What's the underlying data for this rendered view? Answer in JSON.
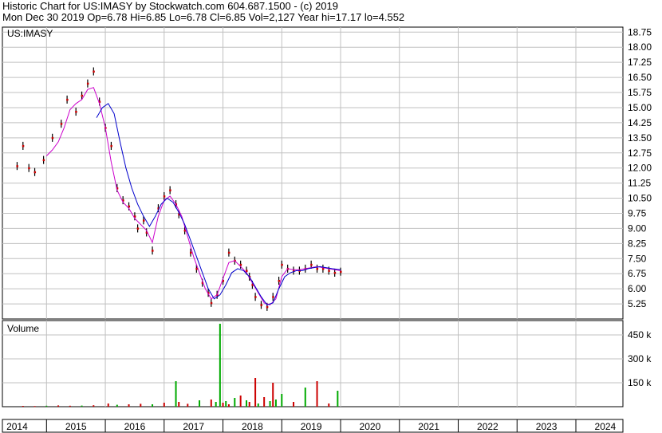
{
  "header": {
    "line1": "Historic Chart for US:IMASY by Stockwatch.com 604.687.1500 - (c) 2019",
    "line2": "Mon Dec 30 2019  Op=6.78  Hi=6.85  Lo=6.78  Cl=6.85  Vol=2,127  Year hi=17.17  lo=4.552"
  },
  "colors": {
    "price": "#cc0000",
    "bar": "#000000",
    "ma_short": "#cc00cc",
    "ma_long": "#0000cc",
    "volume_up": "#00aa00",
    "volume_down": "#cc0000",
    "grid": "#c0c0c0"
  },
  "chart_data": [
    {
      "type": "line",
      "title": "US:IMASY",
      "xlabel": "",
      "ylabel": "",
      "x_labels": [
        "2014",
        "2015",
        "2016",
        "2017",
        "2018",
        "2019",
        "2020",
        "2021",
        "2022",
        "2023",
        "2024"
      ],
      "ylim": [
        4.5,
        19.0
      ],
      "y_ticks": [
        "18.75",
        "18.00",
        "17.25",
        "16.50",
        "15.75",
        "15.00",
        "14.25",
        "13.50",
        "12.75",
        "12.00",
        "11.25",
        "10.50",
        "9.75",
        "9.00",
        "8.25",
        "7.50",
        "6.75",
        "6.00",
        "5.25"
      ],
      "grid": true,
      "series": [
        {
          "style": "price",
          "x": [
            2014.0,
            2014.1,
            2014.2,
            2014.3,
            2014.45,
            2014.6,
            2014.75,
            2014.85,
            2015.0,
            2015.1,
            2015.2,
            2015.3,
            2015.4,
            2015.5,
            2015.6,
            2015.7,
            2015.8,
            2015.9,
            2016.0,
            2016.05,
            2016.15,
            2016.2,
            2016.3,
            2016.4,
            2016.5,
            2016.6,
            2016.7,
            2016.75,
            2016.85,
            2016.95,
            2017.05,
            2017.15,
            2017.25,
            2017.3,
            2017.4,
            2017.5,
            2017.6,
            2017.7,
            2017.8,
            2017.9,
            2017.95,
            2018.0,
            2018.05,
            2018.15,
            2018.25,
            2018.35,
            2018.45,
            2018.5,
            2018.6,
            2018.7,
            2018.8,
            2018.9,
            2019.0,
            2019.1,
            2019.2,
            2019.3,
            2019.4,
            2019.5
          ],
          "values": [
            12.1,
            13.1,
            12.0,
            11.8,
            12.4,
            13.5,
            14.2,
            15.4,
            14.8,
            15.6,
            16.2,
            16.8,
            15.3,
            14.0,
            13.1,
            11.0,
            10.4,
            10.1,
            9.6,
            9.0,
            9.4,
            8.8,
            7.9,
            10.0,
            10.6,
            10.9,
            10.2,
            9.7,
            8.9,
            7.8,
            7.0,
            6.3,
            5.8,
            5.3,
            5.7,
            6.4,
            7.8,
            7.4,
            7.2,
            6.9,
            6.6,
            6.2,
            5.6,
            5.2,
            5.1,
            5.6,
            6.4,
            7.2,
            7.0,
            6.9,
            6.9,
            7.0,
            7.2,
            7.0,
            7.0,
            6.9,
            6.8,
            6.85
          ]
        },
        {
          "style": "ma_short",
          "x": [
            2014.5,
            2014.6,
            2014.7,
            2014.8,
            2014.9,
            2015.0,
            2015.1,
            2015.2,
            2015.3,
            2015.4,
            2015.5,
            2015.6,
            2015.7,
            2015.8,
            2015.9,
            2016.0,
            2016.1,
            2016.2,
            2016.3,
            2016.4,
            2016.5,
            2016.6,
            2016.7,
            2016.8,
            2016.9,
            2017.0,
            2017.1,
            2017.2,
            2017.3,
            2017.4,
            2017.5,
            2017.6,
            2017.7,
            2017.8,
            2017.9,
            2018.0,
            2018.1,
            2018.2,
            2018.3,
            2018.4,
            2018.5,
            2018.6,
            2018.7,
            2018.8,
            2018.9,
            2019.0,
            2019.1,
            2019.2,
            2019.3,
            2019.4,
            2019.5
          ],
          "values": [
            12.6,
            12.9,
            13.3,
            14.0,
            14.9,
            15.2,
            15.4,
            15.9,
            16.0,
            15.2,
            14.0,
            12.3,
            10.9,
            10.3,
            10.0,
            9.5,
            9.2,
            8.9,
            8.3,
            9.6,
            10.4,
            10.6,
            10.2,
            9.6,
            8.6,
            7.6,
            6.8,
            6.0,
            5.5,
            5.7,
            6.5,
            7.3,
            7.4,
            7.1,
            6.8,
            6.3,
            5.8,
            5.3,
            5.2,
            5.5,
            6.6,
            7.0,
            6.95,
            6.95,
            7.0,
            7.05,
            7.1,
            7.05,
            7.0,
            6.95,
            6.9
          ]
        },
        {
          "style": "ma_long",
          "x": [
            2015.35,
            2015.45,
            2015.55,
            2015.65,
            2015.75,
            2015.85,
            2015.95,
            2016.05,
            2016.15,
            2016.25,
            2016.35,
            2016.45,
            2016.55,
            2016.65,
            2016.75,
            2016.85,
            2016.95,
            2017.05,
            2017.15,
            2017.25,
            2017.35,
            2017.45,
            2017.55,
            2017.65,
            2017.75,
            2017.85,
            2017.95,
            2018.05,
            2018.15,
            2018.25,
            2018.35,
            2018.45,
            2018.55,
            2018.65,
            2018.75,
            2018.85,
            2018.95,
            2019.05,
            2019.15,
            2019.25,
            2019.35,
            2019.5
          ],
          "values": [
            14.5,
            15.0,
            15.2,
            14.7,
            13.3,
            12.0,
            11.0,
            10.2,
            9.6,
            9.1,
            9.6,
            10.2,
            10.5,
            10.3,
            9.8,
            9.2,
            8.4,
            7.6,
            6.8,
            6.0,
            5.5,
            5.7,
            6.2,
            6.8,
            7.0,
            6.9,
            6.6,
            6.1,
            5.6,
            5.2,
            5.3,
            6.0,
            6.6,
            6.8,
            6.9,
            6.9,
            7.0,
            7.05,
            7.1,
            7.05,
            7.0,
            6.95
          ]
        }
      ]
    },
    {
      "type": "bar",
      "title": "Volume",
      "x_labels": [
        "2014",
        "2015",
        "2016",
        "2017",
        "2018",
        "2019",
        "2020",
        "2021",
        "2022",
        "2023",
        "2024"
      ],
      "ylim": [
        0,
        540
      ],
      "y_ticks": [
        "450 k",
        "300 k",
        "150 k"
      ],
      "y_tick_values": [
        450,
        300,
        150
      ],
      "grid": true,
      "series": [
        {
          "x": [
            2014.1,
            2014.3,
            2014.5,
            2014.7,
            2014.9,
            2015.1,
            2015.3,
            2015.55,
            2015.7,
            2015.9,
            2016.1,
            2016.3,
            2016.5,
            2016.7,
            2016.75,
            2016.9,
            2017.1,
            2017.3,
            2017.38,
            2017.45,
            2017.5,
            2017.55,
            2017.6,
            2017.7,
            2017.8,
            2017.9,
            2017.95,
            2018.05,
            2018.1,
            2018.2,
            2018.3,
            2018.35,
            2018.4,
            2018.5,
            2018.7,
            2018.9,
            2019.1,
            2019.3,
            2019.45
          ],
          "values": [
            5,
            4,
            6,
            8,
            6,
            7,
            9,
            20,
            12,
            15,
            18,
            15,
            25,
            160,
            30,
            18,
            40,
            45,
            30,
            520,
            25,
            35,
            15,
            55,
            70,
            40,
            30,
            180,
            20,
            60,
            35,
            150,
            45,
            80,
            30,
            120,
            160,
            20,
            100
          ],
          "up": [
            false,
            false,
            true,
            false,
            false,
            true,
            false,
            false,
            true,
            false,
            false,
            true,
            false,
            true,
            false,
            false,
            true,
            false,
            true,
            true,
            false,
            true,
            false,
            true,
            false,
            true,
            false,
            false,
            true,
            false,
            true,
            false,
            true,
            true,
            false,
            true,
            false,
            false,
            true
          ]
        }
      ]
    }
  ]
}
